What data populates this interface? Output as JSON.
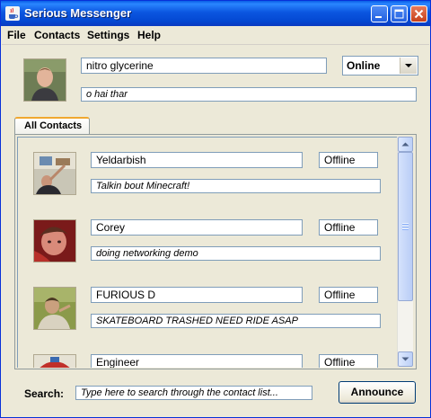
{
  "window": {
    "title": "Serious Messenger",
    "icons": [
      "java-cup-icon",
      "minimize-icon",
      "maximize-icon",
      "close-icon"
    ]
  },
  "menu": {
    "file": "File",
    "contacts": "Contacts",
    "settings": "Settings",
    "help": "Help"
  },
  "profile": {
    "name": "nitro glycerine",
    "status": "Online",
    "message": "o hai thar"
  },
  "tabs": {
    "all_contacts": "All Contacts"
  },
  "contacts": [
    {
      "name": "Yeldarbish",
      "status": "Offline",
      "message": "Talkin bout Minecraft!"
    },
    {
      "name": "Corey",
      "status": "Offline",
      "message": "doing networking demo"
    },
    {
      "name": "FURIOUS D",
      "status": "Offline",
      "message": "SKATEBOARD TRASHED NEED RIDE ASAP"
    },
    {
      "name": "Engineer",
      "status": "Offline",
      "message": ""
    }
  ],
  "search": {
    "label": "Search:",
    "placeholder": "Type here to search through the contact list..."
  },
  "actions": {
    "announce": "Announce"
  },
  "colors": {
    "titlebar": "#0b56e0",
    "window_bg": "#ece9d8",
    "field_border": "#7f9db9",
    "tab_accent": "#f0a830"
  }
}
